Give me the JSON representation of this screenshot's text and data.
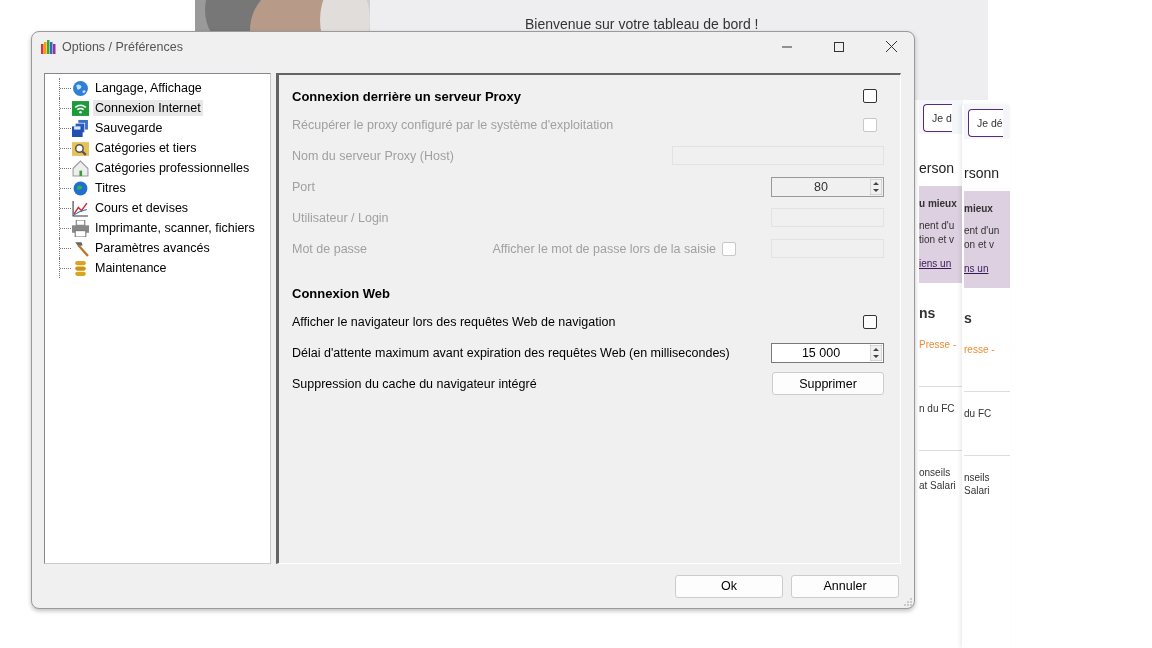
{
  "background": {
    "welcome": "Bienvenue sur votre tableau de bord !",
    "panels": [
      {
        "button": "Je d",
        "heading": "erson",
        "card": {
          "title": "u mieux",
          "lines": [
            "nent d'u",
            "tion et v"
          ],
          "link": "iens un"
        },
        "section": "ns",
        "tag": "Presse -",
        "items": [
          [
            "n du FC"
          ],
          [
            "onseils",
            "at Salari"
          ]
        ]
      },
      {
        "button": "Je dé",
        "heading": "rsonn",
        "card": {
          "title": "mieux",
          "lines": [
            "ent d'un",
            "on et v"
          ],
          "link": "ns un"
        },
        "section": "s",
        "tag": "resse -",
        "items": [
          [
            "du FC"
          ],
          [
            "nseils",
            "Salari"
          ]
        ]
      }
    ]
  },
  "window": {
    "title": "Options / Préférences"
  },
  "tree": [
    {
      "label": "Langage, Affichage",
      "selected": false
    },
    {
      "label": "Connexion Internet",
      "selected": true
    },
    {
      "label": "Sauvegarde",
      "selected": false
    },
    {
      "label": "Catégories et tiers",
      "selected": false
    },
    {
      "label": "Catégories professionnelles",
      "selected": false
    },
    {
      "label": "Titres",
      "selected": false
    },
    {
      "label": "Cours et devises",
      "selected": false
    },
    {
      "label": "Imprimante, scanner, fichiers",
      "selected": false
    },
    {
      "label": "Paramètres avancés",
      "selected": false
    },
    {
      "label": "Maintenance",
      "selected": false
    }
  ],
  "sections": [
    {
      "title": "Connexion derrière un serveur Proxy",
      "checked": false,
      "rows": [
        {
          "kind": "checkbox",
          "label": "Récupérer le proxy configuré par le système d'exploitation",
          "checked": false,
          "disabled": true
        },
        {
          "kind": "wide_text",
          "label": "Nom du serveur Proxy (Host)",
          "disabled": true
        },
        {
          "kind": "spin",
          "label": "Port",
          "value": "80",
          "disabled": true
        },
        {
          "kind": "text",
          "label": "Utilisateur / Login",
          "disabled": true
        },
        {
          "kind": "password",
          "label": "Mot de passe",
          "option": "Afficher le mot de passe lors de la saisie",
          "option_checked": false,
          "disabled": true
        }
      ]
    },
    {
      "title": "Connexion Web",
      "rows": [
        {
          "kind": "checkbox",
          "label": "Afficher le navigateur lors des requêtes Web de navigation",
          "checked": false,
          "disabled": false
        },
        {
          "kind": "spin",
          "label": "Délai d'attente maximum avant expiration des requêtes Web (en millisecondes)",
          "value": "15 000",
          "disabled": false
        },
        {
          "kind": "button",
          "label": "Suppression du cache du navigateur intégré",
          "button": "Supprimer",
          "disabled": false
        }
      ]
    }
  ],
  "buttons": [
    "Ok",
    "Annuler"
  ]
}
